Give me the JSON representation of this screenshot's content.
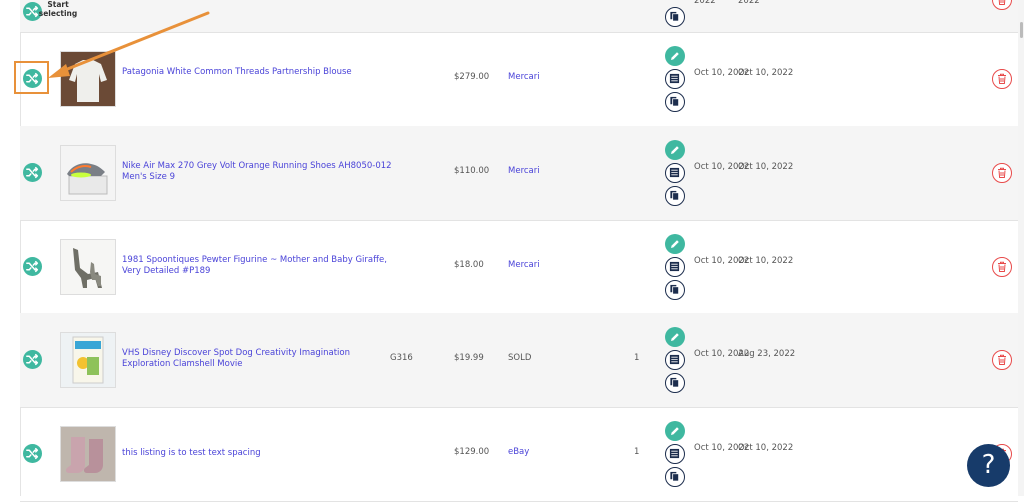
{
  "header": {
    "start_selecting": "Start selecting"
  },
  "top_row": {
    "date_a": "2022",
    "date_b": "2022"
  },
  "rows": [
    {
      "title": "Patagonia White Common Threads Partnership Blouse",
      "sku": "",
      "price": "$279.00",
      "marketplace": "Mercari",
      "qty": "",
      "date_a": "Oct 10, 2022",
      "date_b": "Oct 10, 2022",
      "image": "white-blouse"
    },
    {
      "title": "Nike Air Max 270 Grey Volt Orange Running Shoes AH8050-012 Men's Size 9",
      "sku": "",
      "price": "$110.00",
      "marketplace": "Mercari",
      "qty": "",
      "date_a": "Oct 10, 2022",
      "date_b": "Oct 10, 2022",
      "image": "sneakers-on-box"
    },
    {
      "title": "1981 Spoontiques Pewter Figurine ~ Mother and Baby Giraffe, Very Detailed #P189",
      "sku": "",
      "price": "$18.00",
      "marketplace": "Mercari",
      "qty": "",
      "date_a": "Oct 10, 2022",
      "date_b": "Oct 10, 2022",
      "image": "pewter-giraffe"
    },
    {
      "title": "VHS Disney Discover Spot Dog Creativity Imagination Exploration Clamshell Movie",
      "sku": "G316",
      "price": "$19.99",
      "marketplace": "SOLD",
      "qty": "1",
      "date_a": "Oct 10, 2022",
      "date_b": "Aug 23, 2022",
      "image": "vhs-discover-spot"
    },
    {
      "title": "this listing is to test text spacing",
      "sku": "",
      "price": "$129.00",
      "marketplace": "eBay",
      "qty": "1",
      "date_a": "Oct 10, 2022",
      "date_b": "Oct 10, 2022",
      "image": "pink-boots"
    }
  ],
  "help_button": {
    "label": "?"
  },
  "colors": {
    "accent": "#3fb8a0",
    "link": "#4a43d8",
    "delete": "#e84a4a",
    "annotation": "#e8913a",
    "help_bg": "#173b6a"
  },
  "icons": [
    "shuffle-icon",
    "pencil-icon",
    "list-icon",
    "copy-icon",
    "trash-icon",
    "question-icon"
  ]
}
